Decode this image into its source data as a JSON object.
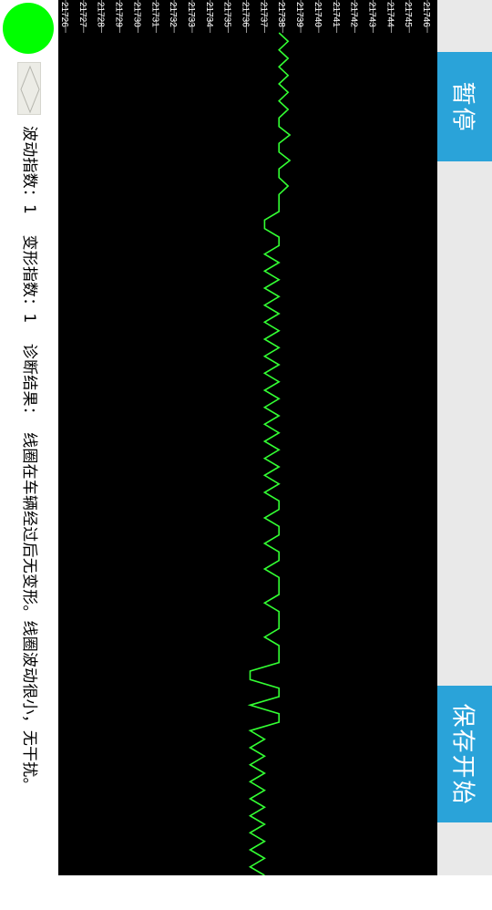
{
  "status": {
    "indicator_color": "#00ff00"
  },
  "info": {
    "fluctuation_label": "波动指数：",
    "fluctuation_value": "1",
    "deformation_label": "变形指数：",
    "deformation_value": "1",
    "diagnosis_label": "诊断结果：",
    "diagnosis_text": "线圈在车辆经过后无变形。线圈波动很小，无干扰。"
  },
  "buttons": {
    "pause_label": "暂停",
    "save_start_label": "保存开始"
  },
  "colors": {
    "accent_button": "#2aa3d9",
    "signal": "#33ff33",
    "chart_bg": "#000000"
  },
  "chart_data": {
    "type": "line",
    "title": "",
    "xlabel": "",
    "ylabel": "",
    "tick_labels": [
      "21726",
      "21727",
      "21728",
      "21729",
      "21730",
      "21731",
      "21732",
      "21733",
      "21734",
      "21735",
      "21736",
      "21737",
      "21738",
      "21739",
      "21740",
      "21741",
      "21742",
      "21743",
      "21744",
      "21745",
      "21746"
    ],
    "xlim": [
      21726,
      21746
    ],
    "series": [
      {
        "values_along_time_axis": [
          21737.8,
          21738.3,
          21737.8,
          21738.3,
          21737.8,
          21738.3,
          21737.8,
          21738.3,
          21737.8,
          21738.3,
          21737.8,
          21737.8,
          21738.4,
          21737.8,
          21737.8,
          21738.4,
          21737.8,
          21737.8,
          21738.3,
          21737.8,
          21737.8,
          21737.8,
          21737.0,
          21737.0,
          21737.8,
          21737.8,
          21737.0,
          21737.8,
          21737.0,
          21737.8,
          21737.0,
          21737.8,
          21737.0,
          21737.8,
          21737.0,
          21737.8,
          21737.0,
          21737.8,
          21737.0,
          21737.8,
          21737.0,
          21737.8,
          21737.0,
          21737.8,
          21737.0,
          21737.8,
          21737.0,
          21737.8,
          21737.0,
          21737.8,
          21737.0,
          21737.8,
          21737.0,
          21737.8,
          21737.0,
          21737.8,
          21737.8,
          21737.0,
          21737.8,
          21737.8,
          21737.0,
          21737.8,
          21737.8,
          21737.0,
          21737.8,
          21737.8,
          21737.8,
          21737.0,
          21737.8,
          21737.8,
          21737.8,
          21737.0,
          21737.8,
          21737.8,
          21737.8,
          21736.2,
          21736.2,
          21737.8,
          21737.8,
          21736.2,
          21737.8,
          21737.8,
          21736.2,
          21737.0,
          21736.2,
          21737.0,
          21736.2,
          21737.0,
          21736.2,
          21737.0,
          21736.2,
          21737.0,
          21736.2,
          21737.0,
          21736.2,
          21737.0,
          21736.2,
          21737.0,
          21736.2,
          21737.0
        ]
      }
    ]
  }
}
